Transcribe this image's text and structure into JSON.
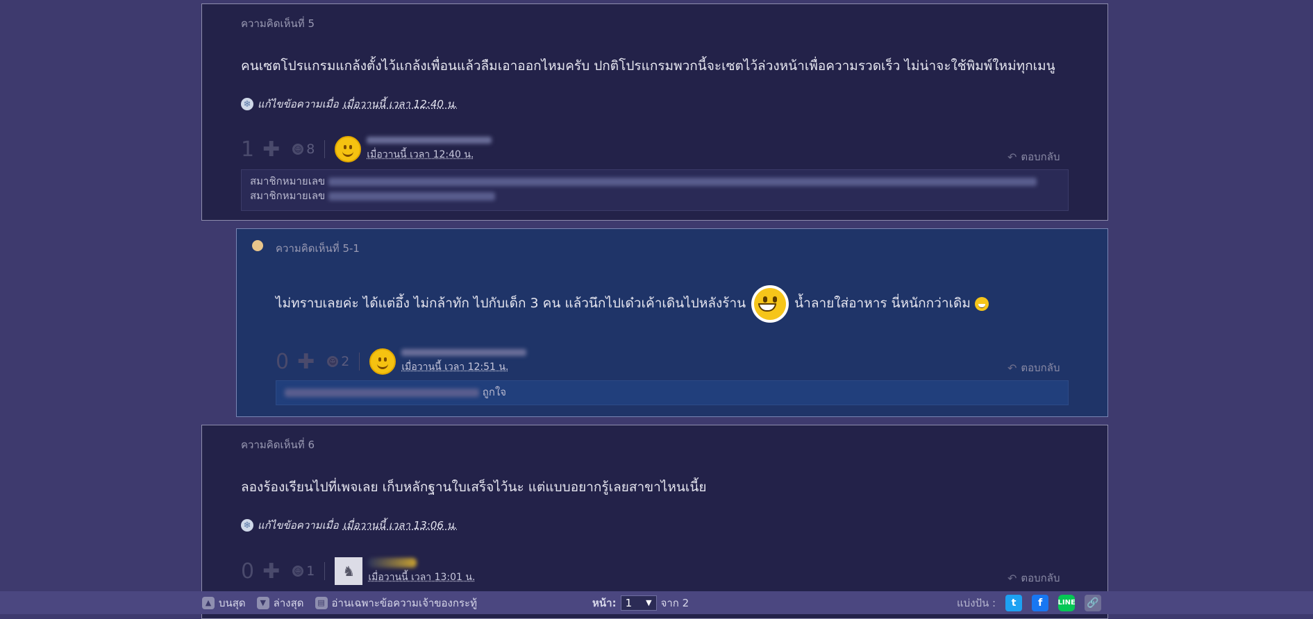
{
  "comments": [
    {
      "number": "ความคิดเห็นที่ 5",
      "text": "คนเซตโปรแกรมแกล้งตั้งไว้แกล้งเพื่อนแล้วลืมเอาออกไหมครับ ปกติโปรแกรมพวกนี้จะเซตไว้ล่วงหน้าเพื่อความรวดเร็ว ไม่น่าจะใช้พิมพ์ใหม่ทุกเมนู",
      "edit_label": "แก้ไขข้อความเมื่อ",
      "edit_time": "เมื่อวานนี้ เวลา 12:40 น.",
      "votes": "1",
      "emotions": "8",
      "post_time": "เมื่อวานนี้ เวลา 12:40 น.",
      "reply_label": "ตอบกลับ",
      "emotion_lines": [
        "สมาชิกหมายเลข",
        "สมาชิกหมายเลข"
      ]
    },
    {
      "number": "ความคิดเห็นที่ 5-1",
      "text_before": "ไม่ทราบเลยค่ะ ได้แต่อึ้ง ไม่กล้าทัก ไปกับเด็ก 3 คน แล้วนึกไปเด๋วเค้าเดินไปหลังร้าน",
      "text_after": "น้ำลายใส่อาหาร นี่หนักกว่าเดิม",
      "votes": "0",
      "emotions": "2",
      "post_time": "เมื่อวานนี้ เวลา 12:51 น.",
      "reply_label": "ตอบกลับ",
      "emotion_text": "ถูกใจ"
    },
    {
      "number": "ความคิดเห็นที่ 6",
      "text": "ลองร้องเรียนไปที่เพจเลย เก็บหลักฐานใบเสร็จไว้นะ แต่แบบอยากรู้เลยสาขาไหนเนี้ย",
      "edit_label": "แก้ไขข้อความเมื่อ",
      "edit_time": "เมื่อวานนี้ เวลา 13:06 น.",
      "votes": "0",
      "emotions": "1",
      "post_time": "เมื่อวานนี้ เวลา 13:01 น.",
      "reply_label": "ตอบกลับ"
    }
  ],
  "bottom_bar": {
    "top_label": "บนสุด",
    "bottom_label": "ล่างสุด",
    "owner_only_label": "อ่านเฉพาะข้อความเจ้าของกระทู้",
    "page_label": "หน้า:",
    "page_value": "1",
    "page_total": "จาก 2",
    "share_label": "แบ่งปัน :"
  },
  "colors": {
    "background": "#3e3a6e",
    "card": "#232249",
    "reply_card": "#1f3468",
    "bottom_bar": "#4b4780",
    "twitter": "#1da1f2",
    "facebook": "#1877f2",
    "line": "#06c755"
  },
  "icons": [
    "plus-icon",
    "emotion-icon",
    "reply-arrow-icon",
    "edit-snowflake-icon",
    "twitter-icon",
    "facebook-icon",
    "line-icon",
    "link-icon"
  ]
}
